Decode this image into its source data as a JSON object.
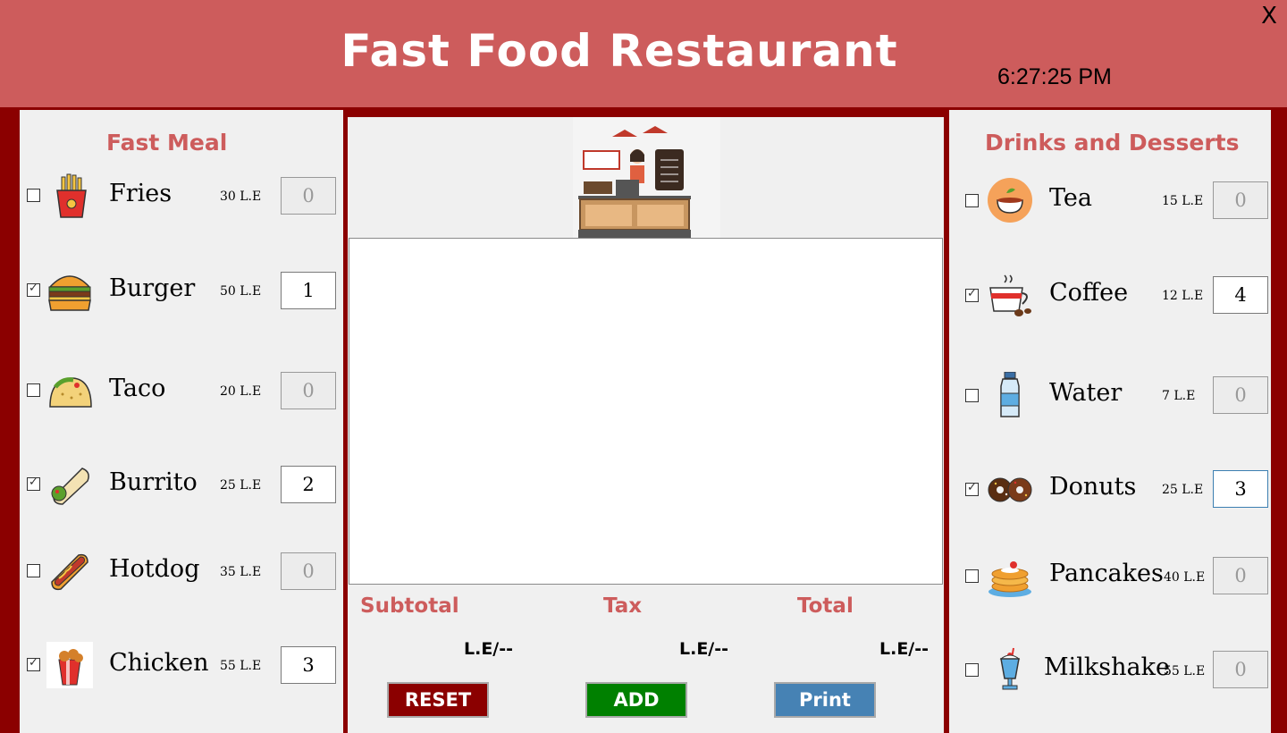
{
  "header": {
    "title": "Fast Food Restaurant",
    "clock": "6:27:25 PM",
    "close_label": "X"
  },
  "fast_meal": {
    "title": "Fast Meal",
    "items": [
      {
        "name": "Fries",
        "price": "30 L.E",
        "qty": "0",
        "checked": false
      },
      {
        "name": "Burger",
        "price": "50 L.E",
        "qty": "1",
        "checked": true
      },
      {
        "name": "Taco",
        "price": "20 L.E",
        "qty": "0",
        "checked": false
      },
      {
        "name": "Burrito",
        "price": "25 L.E",
        "qty": "2",
        "checked": true
      },
      {
        "name": "Hotdog",
        "price": "35 L.E",
        "qty": "0",
        "checked": false
      },
      {
        "name": "Chicken",
        "price": "55 L.E",
        "qty": "3",
        "checked": true
      }
    ]
  },
  "drinks": {
    "title": "Drinks and Desserts",
    "items": [
      {
        "name": "Tea",
        "price": "15 L.E",
        "qty": "0",
        "checked": false
      },
      {
        "name": "Coffee",
        "price": "12 L.E",
        "qty": "4",
        "checked": true
      },
      {
        "name": "Water",
        "price": "7  L.E",
        "qty": "0",
        "checked": false
      },
      {
        "name": "Donuts",
        "price": "25 L.E",
        "qty": "3",
        "checked": true
      },
      {
        "name": "Pancakes",
        "price": "40 L.E",
        "qty": "0",
        "checked": false
      },
      {
        "name": "Milkshake",
        "price": "55 L.E",
        "qty": "0",
        "checked": false
      }
    ]
  },
  "totals": {
    "subtotal_label": "Subtotal",
    "tax_label": "Tax",
    "total_label": "Total",
    "subtotal_value": "L.E/--",
    "tax_value": "L.E/--",
    "total_value": "L.E/--"
  },
  "buttons": {
    "reset": "RESET",
    "add": "ADD",
    "print": "Print"
  },
  "colors": {
    "header": "#cd5c5c",
    "frame": "#8b0000",
    "accent_text": "#cd5c5c",
    "reset": "#8b0000",
    "add": "#008000",
    "print": "#4682b4"
  }
}
